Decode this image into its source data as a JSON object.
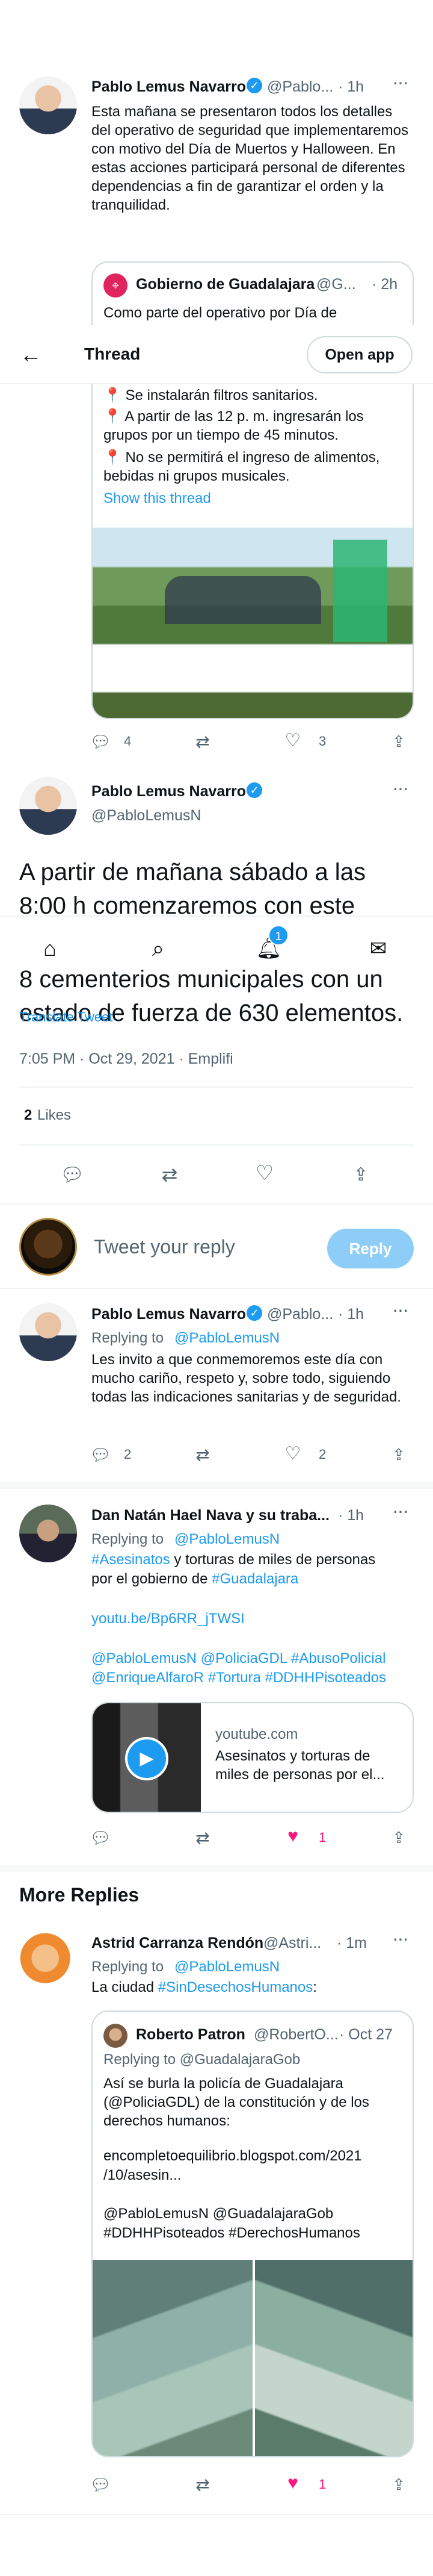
{
  "header": {
    "back_label": "←",
    "title": "Thread",
    "open_app": "Open app"
  },
  "tweet1": {
    "name": "Pablo Lemus Navarro",
    "handle": "@Pablo...",
    "time": "· 1h",
    "text": "Esta mañana se presentaron todos los detalles del operativo de seguridad que implementaremos con motivo del Día de Muertos y Halloween. En estas acciones participará personal de diferentes dependencias a fin de garantizar el orden y la tranquilidad.",
    "quote": {
      "name": "Gobierno de Guadalajara",
      "handle": "@G...",
      "time": "· 2h",
      "lines": [
        "Como parte del operativo por Día de",
        "📍 Se instalarán filtros sanitarios.",
        "📍 A partir de las 12 p. m. ingresarán los grupos por un tiempo de 45 minutos.",
        "📍 No se permitirá el ingreso de alimentos, bebidas ni grupos musicales."
      ],
      "show_thread": "Show this thread"
    },
    "replies": "4",
    "likes": "3"
  },
  "main": {
    "name": "Pablo Lemus Navarro",
    "handle": "@PabloLemusN",
    "text_top": "A partir de mañana sábado a las 8:00 h comenzaremos con este",
    "text_bottom": "8 cementerios municipales con un estado de fuerza de 630 elementos.",
    "translate": "Translate Tweet",
    "meta": "7:05 PM · Oct 29, 2021 · Emplifi",
    "likes_count": "2",
    "likes_label": "Likes"
  },
  "bottom_nav": {
    "badge": "1"
  },
  "compose": {
    "placeholder": "Tweet your reply",
    "reply_button": "Reply"
  },
  "reply1": {
    "name": "Pablo Lemus Navarro",
    "handle": "@Pablo...",
    "time": "· 1h",
    "replying": "Replying to",
    "replying_to": "@PabloLemusN",
    "text": "Les invito a que conmemoremos este día con mucho cariño, respeto y, sobre todo, siguiendo todas las indicaciones sanitarias y de seguridad.",
    "replies": "2",
    "likes": "2"
  },
  "reply2": {
    "name": "Dan Natán Hael Nava y su traba...",
    "time": "· 1h",
    "replying": "Replying to",
    "replying_to": "@PabloLemusN",
    "line1_tag": "#Asesinatos",
    "line1_rest": " y torturas de miles de personas",
    "line2_start": "por el gobierno de ",
    "line2_tag": "#Guadalajara",
    "url": "youtu.be/Bp6RR_jTWSI",
    "tags1": "@PabloLemusN @PoliciaGDL #AbusoPolicial",
    "tags2": "@EnriqueAlfaroR #Tortura #DDHHPisoteados",
    "card_domain": "youtube.com",
    "card_title": "Asesinatos y torturas de miles de personas por el...",
    "likes": "1"
  },
  "more_replies": "More Replies",
  "reply3": {
    "name": "Astrid Carranza Rendón",
    "handle": "@Astri...",
    "time": "· 1m",
    "replying": "Replying to",
    "replying_to": "@PabloLemusN",
    "text_start": "La ciudad ",
    "text_tag": "#SinDesechosHumanos",
    "text_end": ":",
    "quote": {
      "name": "Roberto Patron",
      "handle": "@RobertO...",
      "time": "· Oct 27",
      "replying": "Replying to @GuadalajaraGob",
      "text": "Así se burla la policía de Guadalajara (@PoliciaGDL) de la constitución y de los derechos humanos:",
      "link1": "encompletoequilibrio.blogspot.com/2021",
      "link2": "/10/asesin...",
      "tags1": "@PabloLemusN @GuadalajaraGob",
      "tags2": "#DDHHPisoteados #DerechosHumanos"
    },
    "likes": "1"
  },
  "colors": {
    "accent": "#1d9bf0",
    "like_pink": "#f91880",
    "muted": "#536471"
  }
}
